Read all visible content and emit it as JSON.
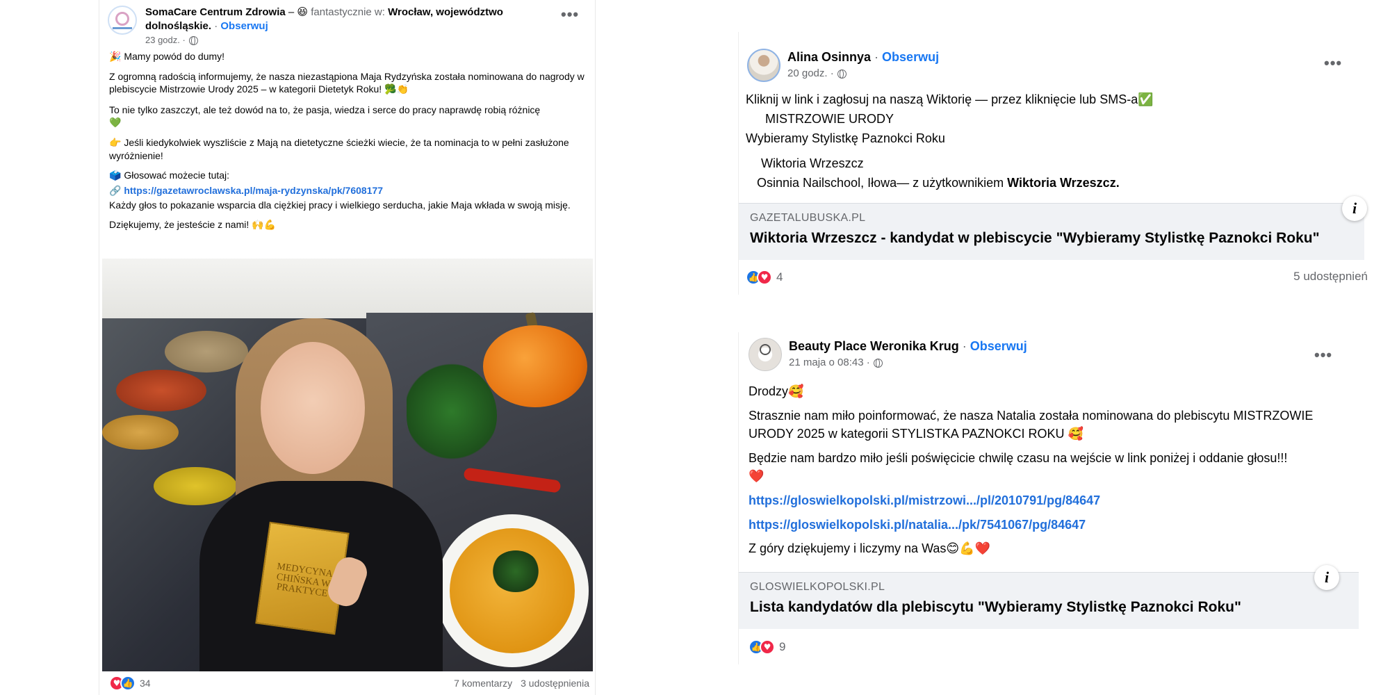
{
  "post1": {
    "author": "SomaCare Centrum Zdrowia",
    "feeling_prefix": " – ",
    "feeling_emoji": "😆",
    "feeling": " fantastycznie w: ",
    "location": "Wrocław, województwo dolnośląskie.",
    "follow_sep": " · ",
    "follow": "Obserwuj",
    "time": "23 godz. ·",
    "lines": {
      "l1_emoji": "🎉",
      "l1": " Mamy powód do dumy!",
      "l2": "Z ogromną radością informujemy, że nasza niezastąpiona Maja Rydzyńska została nominowana do nagrody w plebiscycie Mistrzowie Urody 2025 – w kategorii Dietetyk Roku! ",
      "l2_emoji": "🥦👏",
      "l3": "To nie tylko zaszczyt, ale też dowód na to, że pasja, wiedza i serce do pracy naprawdę robią różnicę",
      "l3_emoji": "💚",
      "l4_emoji": "👉",
      "l4": " Jeśli kiedykolwiek wyszliście z Mają na dietetyczne ścieżki wiecie, że ta nominacja to w pełni zasłużone wyróżnienie!",
      "l5_emoji": "🗳️",
      "l5": " Głosować możecie tutaj:",
      "l6_emoji": "🔗",
      "l6": " https://gazetawroclawska.pl/maja-rydzynska/pk/7608177",
      "l7": "Każdy głos to pokazanie wsparcia dla ciężkiej pracy i wielkiego serducha, jakie Maja wkłada w swoją misję.",
      "l8": "Dziękujemy, że jesteście z nami! ",
      "l8_emoji": "🙌💪"
    },
    "book_title": "MEDYCYNA CHIŃSKA W PRAKTYCE",
    "reactions": "34",
    "comments": "7 komentarzy",
    "shares": "3 udostępnienia"
  },
  "post2": {
    "author": "Alina Osinnya",
    "follow_sep": " · ",
    "follow": "Obserwuj",
    "time": "20 godz. ·",
    "l1": "Kliknij w link i zagłosuj na naszą Wiktorię — przez kliknięcie lub SMS-a",
    "l1_emoji": "✅",
    "l2": "MISTRZOWIE URODY",
    "l3": "Wybieramy Stylistkę Paznokci Roku",
    "l4": "Wiktoria Wrzeszcz",
    "l5": "Osinnia Nailschool, Iłowa— z użytkownikiem ",
    "l5_bold": "Wiktoria Wrzeszcz.",
    "card_domain": "GAZETALUBUSKA.PL",
    "card_title": "Wiktoria Wrzeszcz - kandydat w plebiscycie \"Wybieramy Stylistkę Paznokci Roku\"",
    "reactions": "4",
    "shares": "5 udostępnień"
  },
  "post3": {
    "author": "Beauty Place Weronika Krug",
    "follow_sep": " · ",
    "follow": "Obserwuj",
    "time": "21 maja o 08:43 ·",
    "l1": "Drodzy",
    "l1_emoji": "🥰",
    "l2": "Strasznie nam miło poinformować, że nasza Natalia została nominowana do plebiscytu MISTRZOWIE URODY 2025 w kategorii STYLISTKA PAZNOKCI ROKU ",
    "l2_emoji": "🥰",
    "l3": "Będzie nam bardzo miło jeśli poświęcicie chwilę czasu na wejście w link poniżej i oddanie głosu!!!",
    "l3_emoji": "❤️",
    "link1": "https://gloswielkopolski.pl/mistrzowi.../pl/2010791/pg/84647",
    "link2": "https://gloswielkopolski.pl/natalia.../pk/7541067/pg/84647",
    "l4": "Z góry dziękujemy i liczymy na Was",
    "l4_emoji": "😊💪❤️",
    "card_domain": "GLOSWIELKOPOLSKI.PL",
    "card_title": "Lista kandydatów dla plebiscytu \"Wybieramy Stylistkę Paznokci Roku\"",
    "reactions": "9"
  },
  "icons": {
    "like": "👍",
    "love": "♥",
    "more": "•••",
    "info": "i"
  }
}
